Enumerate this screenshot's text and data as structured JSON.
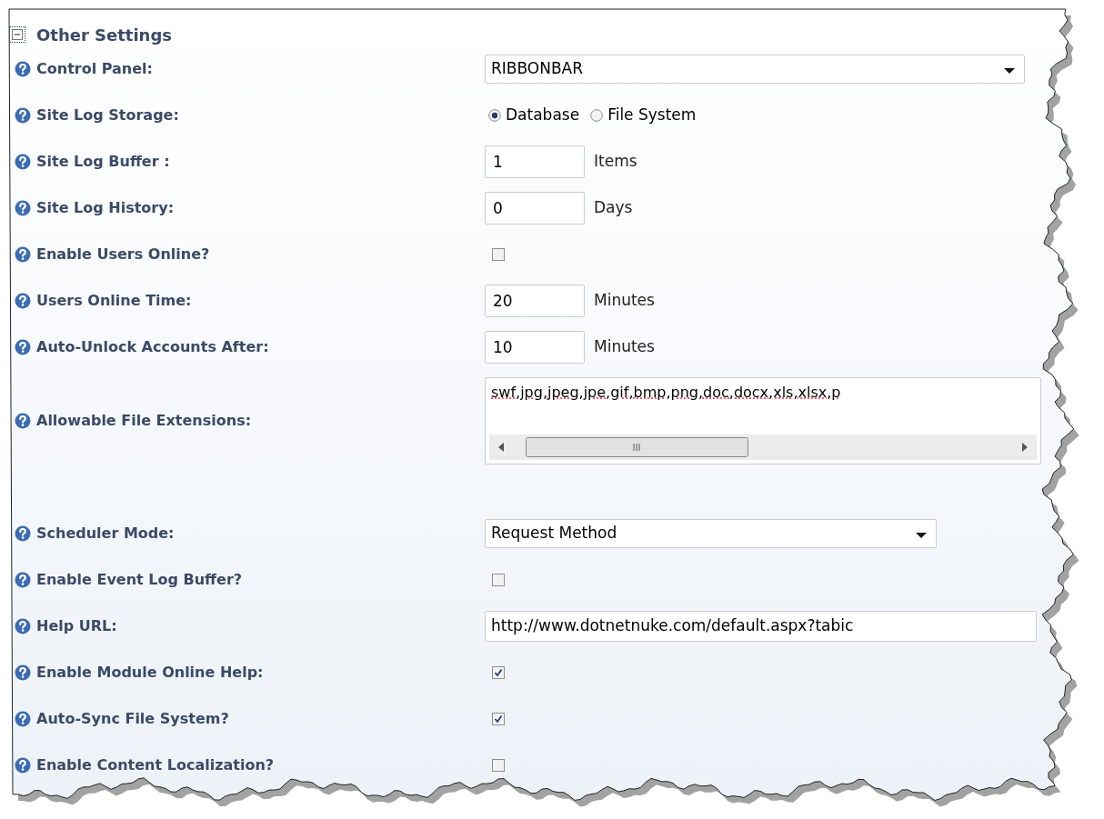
{
  "section": {
    "title": "Other Settings",
    "expanded": true
  },
  "settings": [
    {
      "kind": "select",
      "label": "Control Panel:",
      "value": "RIBBONBAR"
    },
    {
      "kind": "radio",
      "label": "Site Log Storage:",
      "options": [
        {
          "label": "Database",
          "selected": true
        },
        {
          "label": "File System",
          "selected": false
        }
      ]
    },
    {
      "kind": "text",
      "label": "Site Log Buffer :",
      "value": "1",
      "unit": "Items"
    },
    {
      "kind": "text",
      "label": "Site Log History:",
      "value": "0",
      "unit": "Days"
    },
    {
      "kind": "checkbox",
      "label": "Enable Users Online?",
      "checked": false
    },
    {
      "kind": "text",
      "label": "Users Online Time:",
      "value": "20",
      "unit": "Minutes"
    },
    {
      "kind": "text",
      "label": "Auto-Unlock Accounts After:",
      "value": "10",
      "unit": "Minutes"
    },
    {
      "kind": "textarea",
      "label": "Allowable File Extensions:",
      "value": "swf,jpg,jpeg,jpe,gif,bmp,png,doc,docx,xls,xlsx,p"
    },
    {
      "kind": "select",
      "label": "Scheduler Mode:",
      "value": "Request Method"
    },
    {
      "kind": "checkbox",
      "label": "Enable Event Log Buffer?",
      "checked": false
    },
    {
      "kind": "url",
      "label": "Help URL:",
      "value": "http://www.dotnetnuke.com/default.aspx?tabic"
    },
    {
      "kind": "checkbox",
      "label": "Enable Module Online Help:",
      "checked": true
    },
    {
      "kind": "checkbox",
      "label": "Auto-Sync File System?",
      "checked": true
    },
    {
      "kind": "checkbox",
      "label": "Enable Content Localization?",
      "checked": false
    }
  ]
}
